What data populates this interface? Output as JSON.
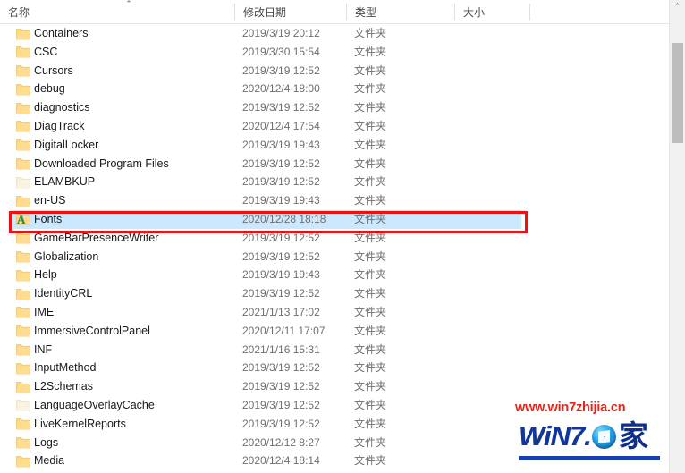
{
  "window": {
    "type": "file-explorer-list-view"
  },
  "columns": {
    "name": "名称",
    "date_modified": "修改日期",
    "type": "类型",
    "size": "大小",
    "sort_indicator": "⌃",
    "sorted_by": "名称",
    "sort_direction": "ascending"
  },
  "scrollbar": {
    "up_arrow": "⌃"
  },
  "rows": [
    {
      "name": "Containers",
      "date": "2019/3/19 20:12",
      "type": "文件夹",
      "size": "",
      "icon": "folder-icon",
      "selected": false,
      "dim": false
    },
    {
      "name": "CSC",
      "date": "2019/3/30 15:54",
      "type": "文件夹",
      "size": "",
      "icon": "folder-icon",
      "selected": false,
      "dim": false
    },
    {
      "name": "Cursors",
      "date": "2019/3/19 12:52",
      "type": "文件夹",
      "size": "",
      "icon": "folder-icon",
      "selected": false,
      "dim": false
    },
    {
      "name": "debug",
      "date": "2020/12/4 18:00",
      "type": "文件夹",
      "size": "",
      "icon": "folder-icon",
      "selected": false,
      "dim": false
    },
    {
      "name": "diagnostics",
      "date": "2019/3/19 12:52",
      "type": "文件夹",
      "size": "",
      "icon": "folder-icon",
      "selected": false,
      "dim": false
    },
    {
      "name": "DiagTrack",
      "date": "2020/12/4 17:54",
      "type": "文件夹",
      "size": "",
      "icon": "folder-icon",
      "selected": false,
      "dim": false
    },
    {
      "name": "DigitalLocker",
      "date": "2019/3/19 19:43",
      "type": "文件夹",
      "size": "",
      "icon": "folder-icon",
      "selected": false,
      "dim": false
    },
    {
      "name": "Downloaded Program Files",
      "date": "2019/3/19 12:52",
      "type": "文件夹",
      "size": "",
      "icon": "folder-icon",
      "selected": false,
      "dim": false
    },
    {
      "name": "ELAMBKUP",
      "date": "2019/3/19 12:52",
      "type": "文件夹",
      "size": "",
      "icon": "folder-icon",
      "selected": false,
      "dim": true
    },
    {
      "name": "en-US",
      "date": "2019/3/19 19:43",
      "type": "文件夹",
      "size": "",
      "icon": "folder-icon",
      "selected": false,
      "dim": false
    },
    {
      "name": "Fonts",
      "date": "2020/12/28 18:18",
      "type": "文件夹",
      "size": "",
      "icon": "fonts-folder-icon",
      "selected": true,
      "dim": false
    },
    {
      "name": "GameBarPresenceWriter",
      "date": "2019/3/19 12:52",
      "type": "文件夹",
      "size": "",
      "icon": "folder-icon",
      "selected": false,
      "dim": false
    },
    {
      "name": "Globalization",
      "date": "2019/3/19 12:52",
      "type": "文件夹",
      "size": "",
      "icon": "folder-icon",
      "selected": false,
      "dim": false
    },
    {
      "name": "Help",
      "date": "2019/3/19 19:43",
      "type": "文件夹",
      "size": "",
      "icon": "folder-icon",
      "selected": false,
      "dim": false
    },
    {
      "name": "IdentityCRL",
      "date": "2019/3/19 12:52",
      "type": "文件夹",
      "size": "",
      "icon": "folder-icon",
      "selected": false,
      "dim": false
    },
    {
      "name": "IME",
      "date": "2021/1/13 17:02",
      "type": "文件夹",
      "size": "",
      "icon": "folder-icon",
      "selected": false,
      "dim": false
    },
    {
      "name": "ImmersiveControlPanel",
      "date": "2020/12/11 17:07",
      "type": "文件夹",
      "size": "",
      "icon": "folder-icon",
      "selected": false,
      "dim": false
    },
    {
      "name": "INF",
      "date": "2021/1/16 15:31",
      "type": "文件夹",
      "size": "",
      "icon": "folder-icon",
      "selected": false,
      "dim": false
    },
    {
      "name": "InputMethod",
      "date": "2019/3/19 12:52",
      "type": "文件夹",
      "size": "",
      "icon": "folder-icon",
      "selected": false,
      "dim": false
    },
    {
      "name": "L2Schemas",
      "date": "2019/3/19 12:52",
      "type": "文件夹",
      "size": "",
      "icon": "folder-icon",
      "selected": false,
      "dim": false
    },
    {
      "name": "LanguageOverlayCache",
      "date": "2019/3/19 12:52",
      "type": "文件夹",
      "size": "",
      "icon": "folder-icon",
      "selected": false,
      "dim": true
    },
    {
      "name": "LiveKernelReports",
      "date": "2019/3/19 12:52",
      "type": "文件夹",
      "size": "",
      "icon": "folder-icon",
      "selected": false,
      "dim": false
    },
    {
      "name": "Logs",
      "date": "2020/12/12 8:27",
      "type": "文件夹",
      "size": "",
      "icon": "folder-icon",
      "selected": false,
      "dim": false
    },
    {
      "name": "Media",
      "date": "2020/12/4 18:14",
      "type": "文件夹",
      "size": "",
      "icon": "folder-icon",
      "selected": false,
      "dim": false
    }
  ],
  "annotation": {
    "shape": "rectangle",
    "color": "#ee1111",
    "target_row": "Fonts"
  },
  "watermark": {
    "url": "www.win7zhijia.cn",
    "logo_text": "WiN7.",
    "logo_suffix": "家",
    "url_color": "#e8231a",
    "logo_color": "#11369c"
  }
}
